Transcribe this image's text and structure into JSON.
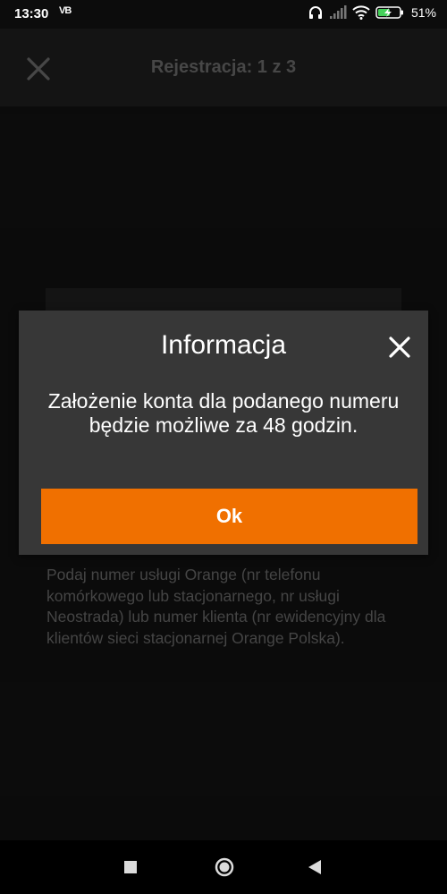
{
  "status_bar": {
    "time": "13:30",
    "app_icon_text": "VB",
    "battery_percent": "51%",
    "icons": [
      "headphones-icon",
      "signal-icon",
      "wifi-icon",
      "battery-charging-icon"
    ]
  },
  "header": {
    "title": "Rejestracja: 1 z 3",
    "close_icon": "close-icon"
  },
  "background": {
    "hint": "Podaj numer usługi Orange (nr telefonu komórkowego lub stacjonarnego, nr usługi Neostrada) lub numer klienta (nr ewidencyjny dla klientów sieci stacjonarnej Orange Polska)."
  },
  "dialog": {
    "title": "Informacja",
    "message": "Założenie konta dla podanego numeru będzie możliwe za 48 godzin.",
    "ok_label": "Ok",
    "close_icon": "close-icon"
  },
  "nav_bar": {
    "icons": [
      "recents-icon",
      "home-icon",
      "back-icon"
    ]
  },
  "colors": {
    "accent": "#f07000",
    "dialog_bg": "#373737",
    "header_bg": "#1f1f1f",
    "page_bg": "#121212"
  }
}
